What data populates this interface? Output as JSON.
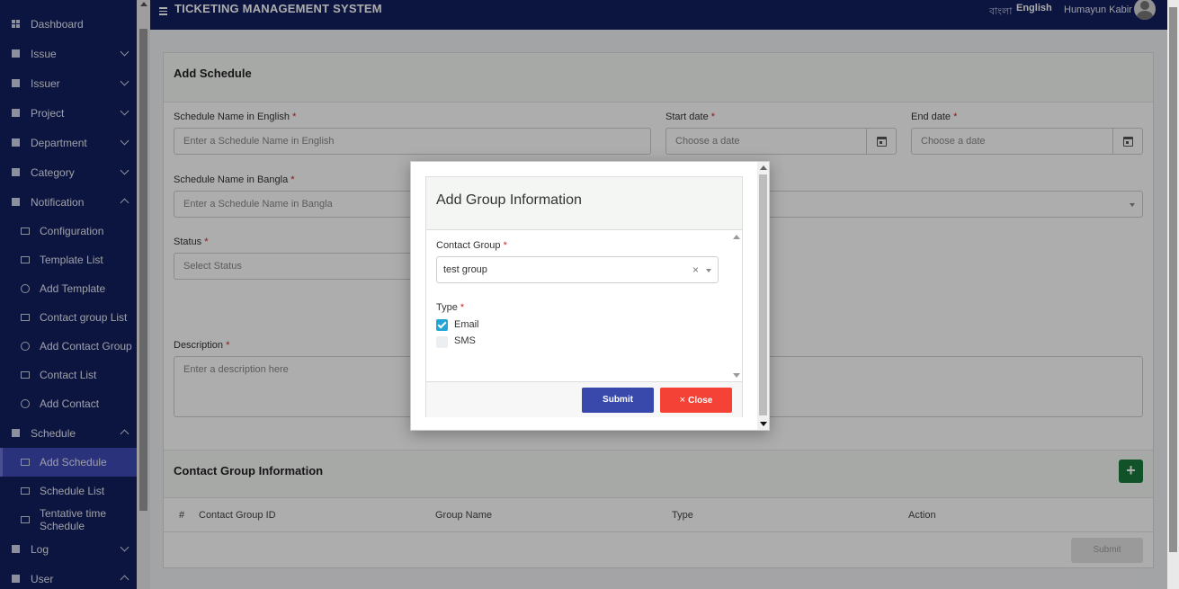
{
  "header": {
    "app_title": "TICKETING MANAGEMENT SYSTEM",
    "lang_bangla": "বাংলা",
    "lang_english": "English",
    "user_name": "Humayun Kabir"
  },
  "sidebar": {
    "items": [
      {
        "label": "Dashboard"
      },
      {
        "label": "Issue"
      },
      {
        "label": "Issuer"
      },
      {
        "label": "Project"
      },
      {
        "label": "Department"
      },
      {
        "label": "Category"
      },
      {
        "label": "Notification"
      },
      {
        "label": "Schedule"
      },
      {
        "label": "Log"
      },
      {
        "label": "User"
      }
    ],
    "notification_sub": [
      {
        "label": "Configuration"
      },
      {
        "label": "Template List"
      },
      {
        "label": "Add Template"
      },
      {
        "label": "Contact group List"
      },
      {
        "label": "Add Contact Group"
      },
      {
        "label": "Contact List"
      },
      {
        "label": "Add Contact"
      }
    ],
    "schedule_sub": [
      {
        "label": "Add Schedule"
      },
      {
        "label": "Schedule List"
      },
      {
        "label": "Tentative time Schedule"
      }
    ]
  },
  "form": {
    "title": "Add Schedule",
    "name_en_label": "Schedule Name in English",
    "name_en_placeholder": "Enter a Schedule Name in English",
    "start_date_label": "Start date",
    "start_date_placeholder": "Choose a date",
    "end_date_label": "End date",
    "end_date_placeholder": "Choose a date",
    "name_bn_label": "Schedule Name in Bangla",
    "name_bn_placeholder": "Enter a Schedule Name in Bangla",
    "status_label": "Status",
    "status_placeholder": "Select Status",
    "description_label": "Description",
    "description_placeholder": "Enter a description here",
    "required_mark": "*"
  },
  "contact_section": {
    "title": "Contact Group Information",
    "add_label": "+",
    "columns": [
      "#",
      "Contact Group ID",
      "Group Name",
      "Type",
      "Action"
    ],
    "submit_label": "Submit"
  },
  "modal": {
    "title": "Add Group Information",
    "contact_group_label": "Contact Group",
    "contact_group_value": "test group",
    "clear_label": "×",
    "type_label": "Type",
    "types": [
      {
        "label": "Email",
        "checked": true
      },
      {
        "label": "SMS",
        "checked": false
      }
    ],
    "submit_label": "Submit",
    "close_label": "Close",
    "close_icon": "×"
  }
}
